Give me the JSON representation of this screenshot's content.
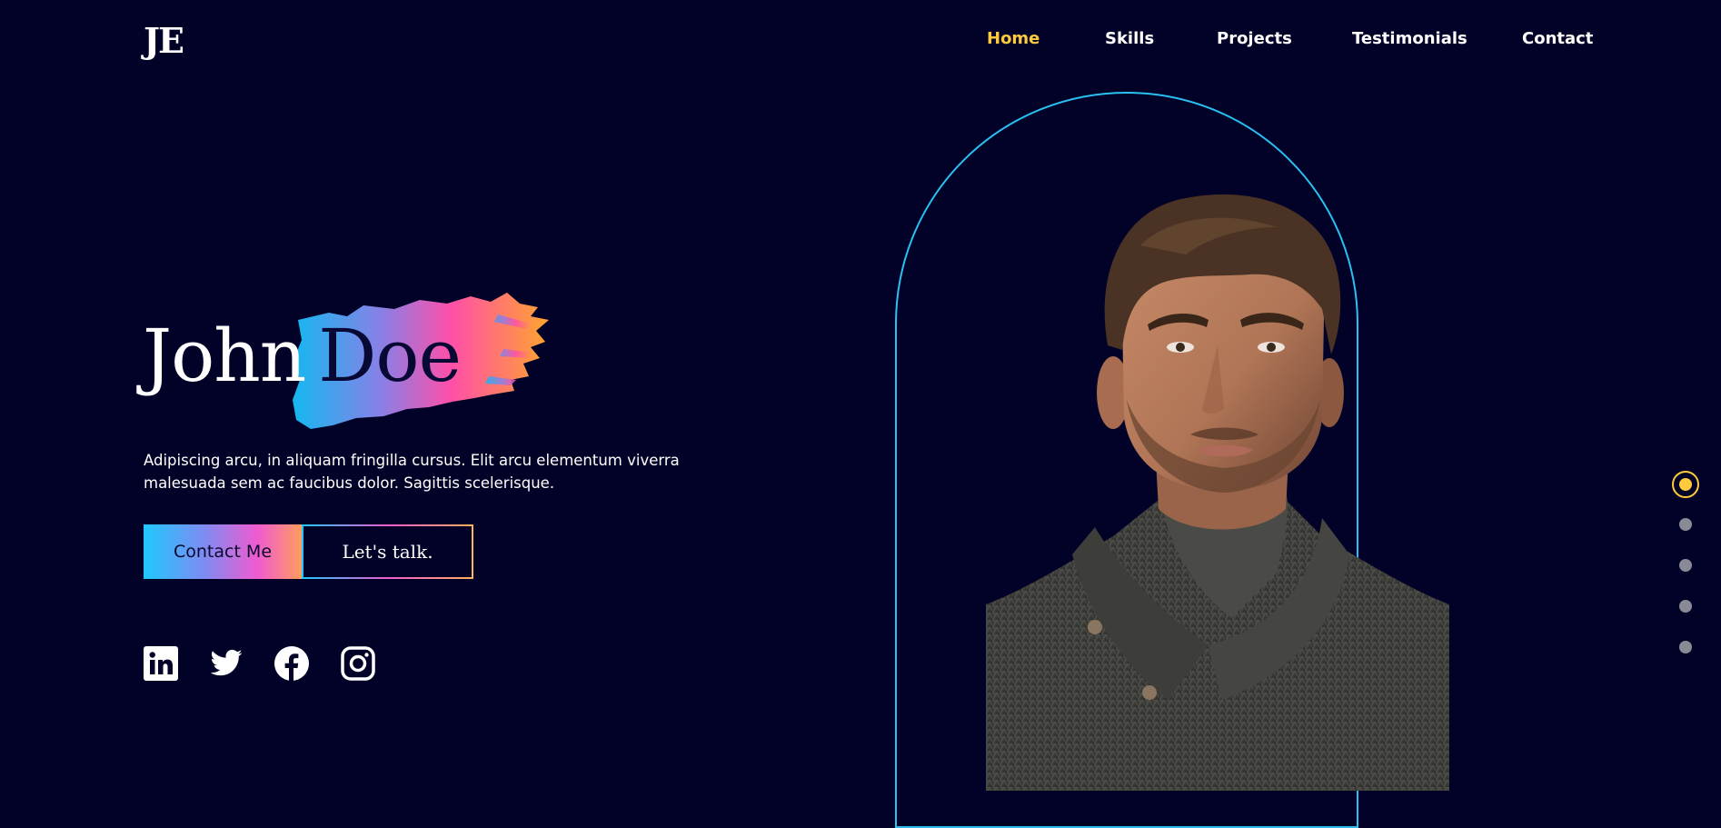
{
  "logo": "JE",
  "nav": {
    "items": [
      {
        "label": "Home",
        "active": true
      },
      {
        "label": "Skills",
        "active": false
      },
      {
        "label": "Projects",
        "active": false
      },
      {
        "label": "Testimonials",
        "active": false
      },
      {
        "label": "Contact",
        "active": false
      }
    ]
  },
  "hero": {
    "first_name": "John",
    "last_name": "Doe",
    "description": "Adipiscing arcu, in aliquam fringilla cursus. Elit arcu elementum viverra malesuada sem ac faucibus dolor. Sagittis scelerisque.",
    "primary_button": "Contact Me",
    "secondary_button": "Let's talk."
  },
  "social": [
    {
      "icon": "linkedin-icon"
    },
    {
      "icon": "twitter-icon"
    },
    {
      "icon": "facebook-icon"
    },
    {
      "icon": "instagram-icon"
    }
  ],
  "side_nav": {
    "count": 5,
    "active_index": 0
  },
  "colors": {
    "background": "#020228",
    "accent": "#ffcb3c",
    "arch_outline": "#29c1f2",
    "gradient": [
      "#1ec9ff",
      "#f05bd0",
      "#ff9c5e"
    ]
  }
}
